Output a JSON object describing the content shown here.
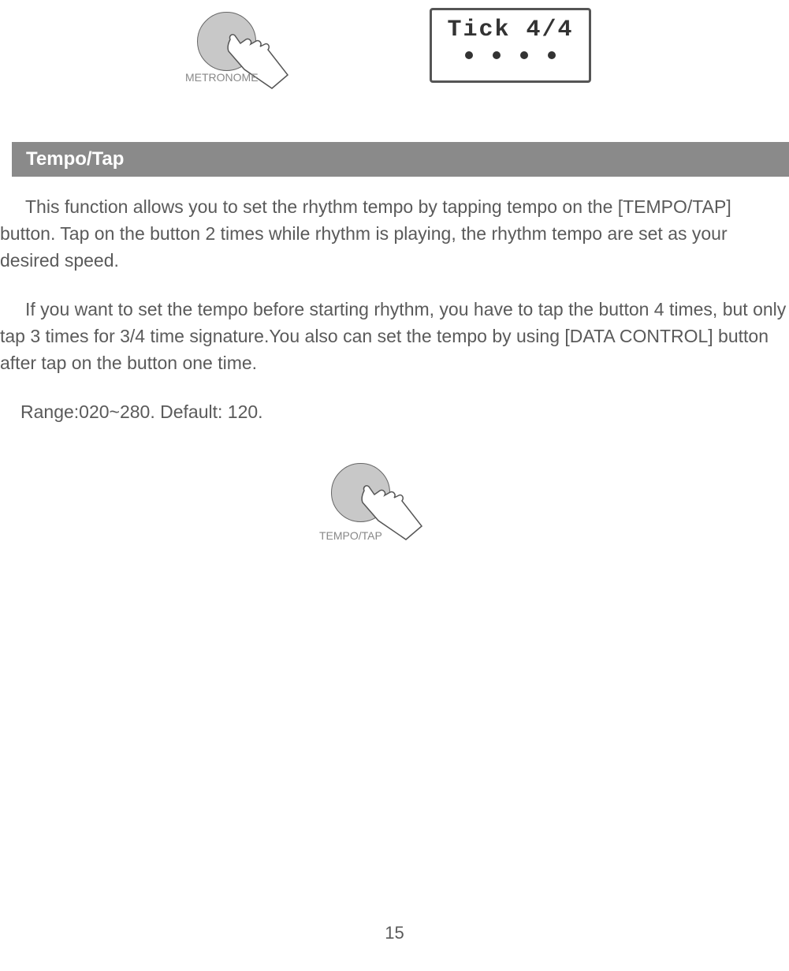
{
  "top_diagram": {
    "metronome_label": "METRONOME",
    "lcd_text": "Tick 4/4",
    "lcd_dot_count": 4
  },
  "section": {
    "title": "Tempo/Tap"
  },
  "paragraphs": {
    "p1": "This function allows you to set the rhythm tempo by tapping tempo on the [TEMPO/TAP] button. Tap on the button 2 times while rhythm is playing, the rhythm tempo are set as your desired speed.",
    "p2": "If you want to set the tempo before starting rhythm, you have to tap the button 4 times, but only tap 3 times for 3/4 time signature.You also can set the tempo by using [DATA CONTROL] button after tap on the button one time.",
    "p3": "Range:020~280. Default: 120."
  },
  "bottom_diagram": {
    "tempo_label": "TEMPO/TAP"
  },
  "page_number": "15"
}
